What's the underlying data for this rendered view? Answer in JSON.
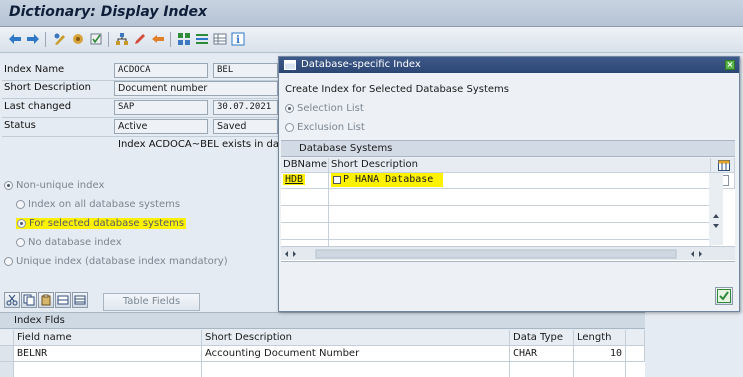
{
  "window": {
    "title": "Dictionary: Display Index"
  },
  "form": {
    "index_name_label": "Index Name",
    "index_name_table": "ACDOCA",
    "index_name_id": "BEL",
    "short_desc_label": "Short Description",
    "short_desc_value": "Document number",
    "last_changed_label": "Last changed",
    "last_changed_user": "SAP",
    "last_changed_date": "30.07.2021",
    "status_label": "Status",
    "status_value": "Active",
    "status_saved": "Saved",
    "exists_text": "Index ACDOCA~BEL exists in data"
  },
  "index_options": {
    "non_unique": "Non-unique index",
    "all_db": "Index on all database systems",
    "selected_db": "For selected database systems",
    "no_db": "No database index",
    "unique": "Unique index (database index mandatory)"
  },
  "fields_area": {
    "table_fields_btn": "Table Fields",
    "section_title": "Index Flds",
    "col_field": "Field name",
    "col_desc": "Short Description",
    "col_type": "Data Type",
    "col_len": "Length",
    "rows": [
      {
        "field": "BELNR",
        "desc": "Accounting Document Number",
        "type": "CHAR",
        "len": "10"
      }
    ]
  },
  "popup": {
    "title": "Database-specific Index",
    "heading": "Create Index for Selected Database Systems",
    "selection_list": "Selection List",
    "exclusion_list": "Exclusion List",
    "db_systems_header": "Database Systems",
    "col_dbname": "DBName",
    "col_short_desc": "Short Description",
    "rows": [
      {
        "dbname": "HDB",
        "desc": "P HANA Database"
      }
    ]
  },
  "colors": {
    "highlight": "#fff200",
    "title_bar": "#2c4674",
    "confirm_green": "#2e8b3a"
  }
}
